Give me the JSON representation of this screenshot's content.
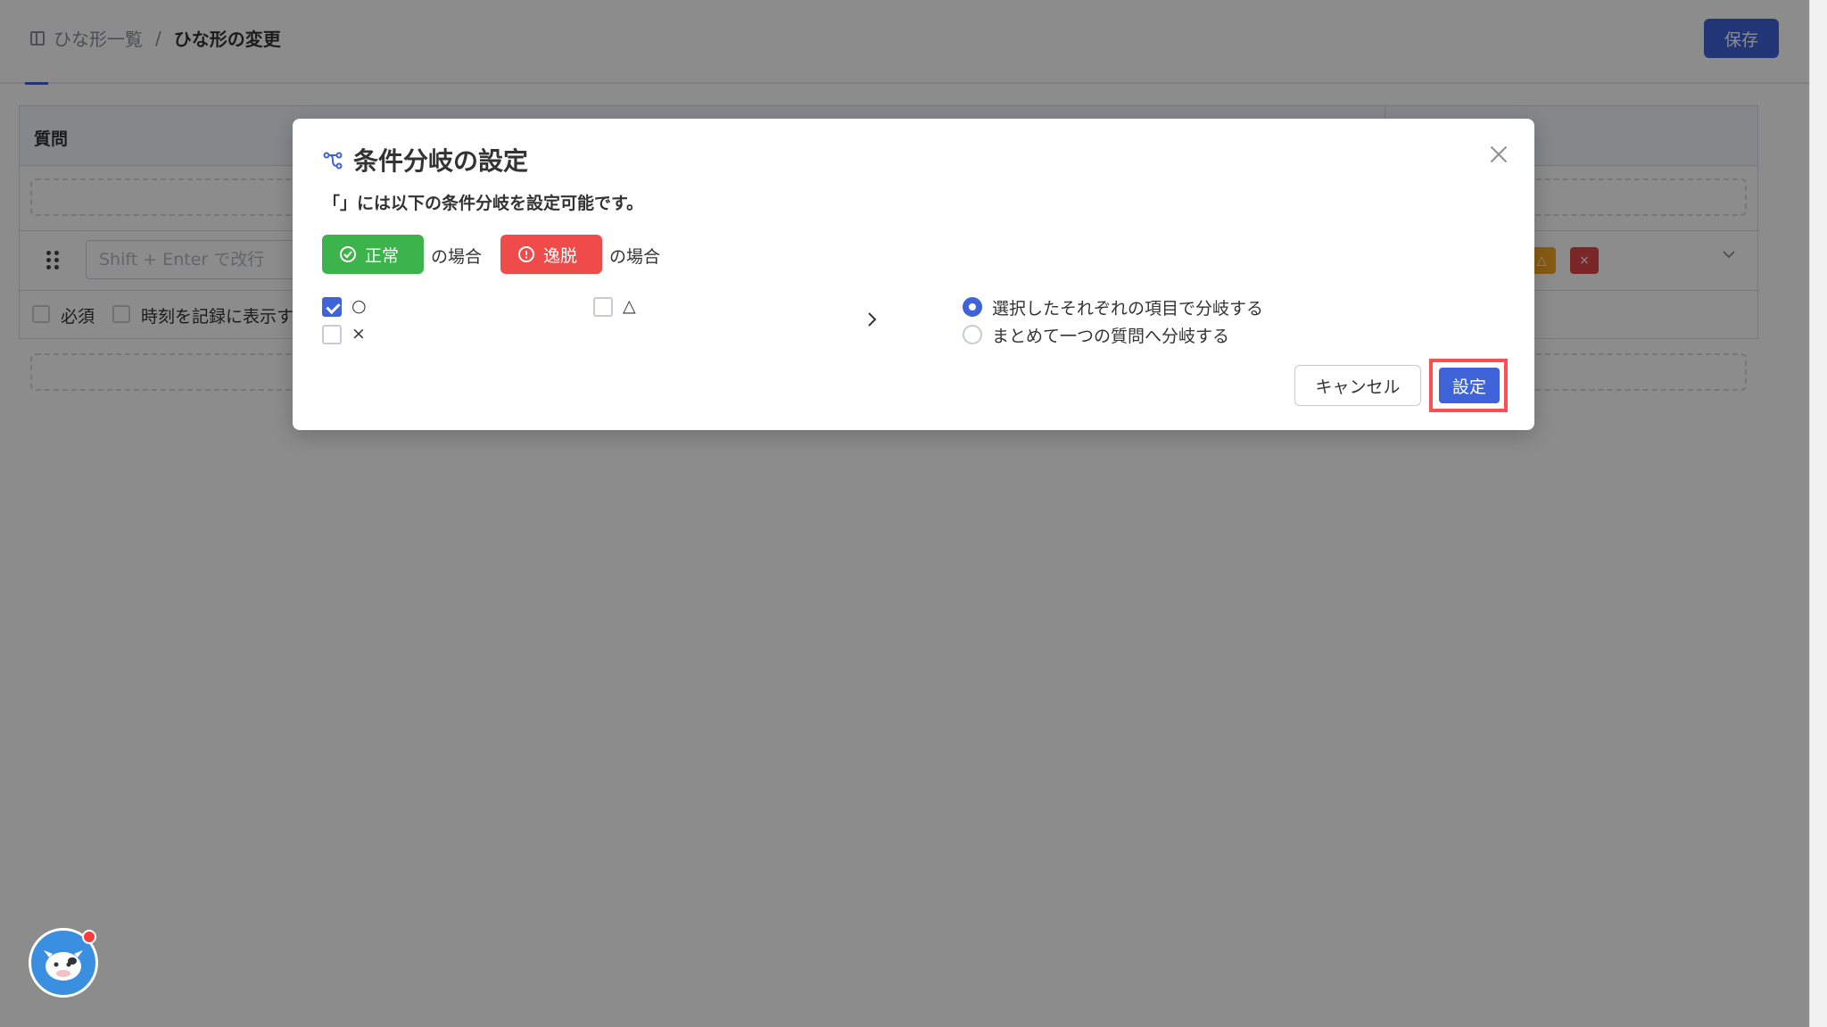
{
  "header": {
    "breadcrumb_parent": "ひな形一覧",
    "breadcrumb_sep": "/",
    "breadcrumb_current": "ひな形の変更",
    "save_label": "保存"
  },
  "table": {
    "header_label": "質問",
    "input_placeholder": "Shift + Enter で改行",
    "badge_triangle": "△",
    "badge_x": "×",
    "required_label": "必須",
    "record_time_label": "時刻を記録に表示す"
  },
  "modal": {
    "title": "条件分岐の設定",
    "description": "「」には以下の条件分岐を設定可能です。",
    "normal_pill": "正常",
    "deviation_pill": "逸脱",
    "case_suffix_normal": "の場合",
    "case_suffix_deviation": "の場合",
    "options": [
      {
        "label": "○",
        "checked": true
      },
      {
        "label": "△",
        "checked": false
      },
      {
        "label": "×",
        "checked": false
      }
    ],
    "branch_modes": [
      {
        "label": "選択したそれぞれの項目で分岐する",
        "selected": true
      },
      {
        "label": "まとめて一つの質問へ分岐する",
        "selected": false
      }
    ],
    "cancel_label": "キャンセル",
    "confirm_label": "設定"
  },
  "colors": {
    "primary": "#3f63d9",
    "normal": "#3cb44b",
    "deviation": "#ef4b4b",
    "highlight": "#ff4d55"
  }
}
